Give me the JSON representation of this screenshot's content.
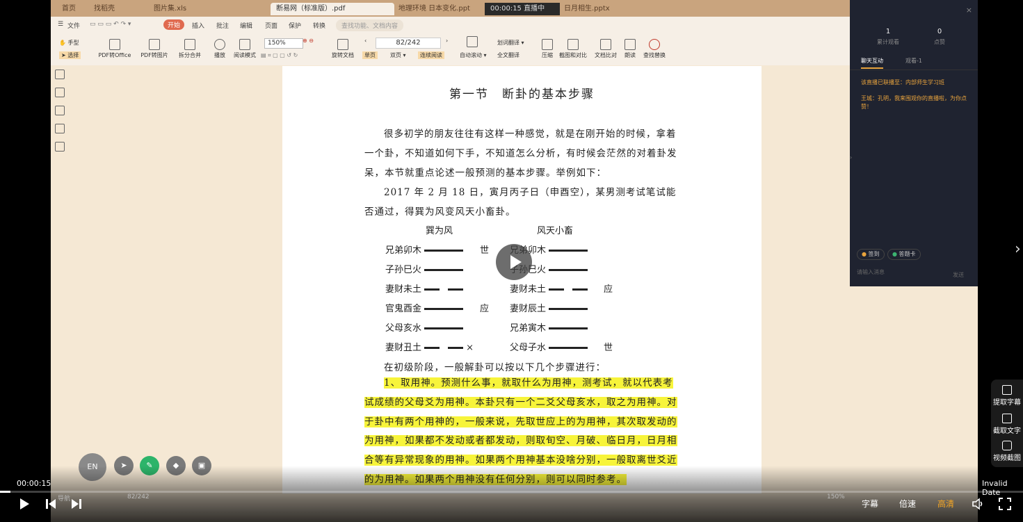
{
  "wps": {
    "tabs": [
      {
        "label": "首页"
      },
      {
        "label": "找稻壳"
      },
      {
        "label": "图片集.xls"
      },
      {
        "label": "断易网（标准版）.pdf"
      },
      {
        "label": "地理环境 日本变化.ppt"
      },
      {
        "label": "00:00:15 直播中"
      },
      {
        "label": "日月相生.pptx"
      }
    ],
    "menu": {
      "file": "文件",
      "start": "开始",
      "insert": "插入",
      "comment": "批注",
      "edit": "编辑",
      "page": "页面",
      "protect": "保护",
      "convert": "转换",
      "search_placeholder": "查找功能、文档内容"
    },
    "ribbon": {
      "hand": "手型",
      "select": "选择",
      "pdf_to_office": "PDF转Office",
      "pdf_to_image": "PDF转图片",
      "split_merge": "拆分合并",
      "play": "播放",
      "read_mode": "阅读模式",
      "zoom": "150%",
      "rotate": "旋转文档",
      "page_value": "82/242",
      "single": "单页",
      "double": "双页",
      "continuous": "连续阅读",
      "auto_scroll": "自动滚动",
      "word_translate": "划词翻译",
      "full_translate": "全文翻译",
      "compress": "压缩",
      "screenshot_compare": "截图和对比",
      "doc_compare": "文档比对",
      "read_aloud": "朗读",
      "find_replace": "查找替换"
    }
  },
  "doc": {
    "title": "第一节　断卦的基本步骤",
    "p1": "很多初学的朋友往往有这样一种感觉，就是在刚开始的时候，拿着一个卦，不知道如何下手，不知道怎么分析，有时候会茫然的对着卦发呆，本节就重点论述一般预测的基本步骤。举例如下：",
    "p2": "2017 年 2 月 18 日，寅月丙子日（申酉空），某男测考试笔试能否通过，得巽为风变风天小畜卦。",
    "hex_left_title": "巽为风",
    "hex_right_title": "风天小畜",
    "left_lines": [
      "兄弟卯木",
      "子孙巳火",
      "妻财未土",
      "官鬼酉金",
      "父母亥水",
      "妻财丑土"
    ],
    "right_lines": [
      "兄弟卯木",
      "子孙巳火",
      "妻财未土",
      "妻财辰土",
      "兄弟寅木",
      "父母子水"
    ],
    "shi": "世",
    "ying": "应",
    "cross": "×",
    "p3": "在初级阶段，一般解卦可以按以下几个步骤进行：",
    "p4": "1、取用神。预测什么事，就取什么为用神，测考试，就以代表考试成绩的父母爻为用神。本卦只有一个二爻父母亥水，取之为用神。对于卦中有两个用神的，一般来说，先取世应上的为用神，其次取发动的为用神，如果都不发动或者都发动，则取旬空、月破、临日月，日月相合等有异常现象的用神。如果两个用神基本没啥分别，一般取离世爻近的为用神。如果两个用神没有任何分别，则可以同时参考。"
  },
  "live": {
    "total_views_num": "1",
    "total_views_label": "累计观看",
    "likes_num": "0",
    "likes_label": "点赞",
    "tab_chat": "聊天互动",
    "tab_viewers": "观看-1",
    "msg1": "该直播已联播至：内部师生学习班",
    "msg2": "王城：孔明，我来围观你的直播啦，为你点赞！",
    "signin": "签到",
    "card": "答题卡",
    "input_placeholder": "请输入消息",
    "send": "发送"
  },
  "drawtools": {
    "en": "EN"
  },
  "bottom_bar": {
    "label": "导航",
    "page": "82/242",
    "zoom": "150%"
  },
  "player": {
    "time": "00:00:15",
    "invalid": "Invalid Date",
    "progress": 0.01,
    "subtitle": "字幕",
    "speed": "倍速",
    "quality": "高清"
  },
  "side_tools": {
    "extract_subtitle": "提取字幕",
    "extract_text": "截取文字",
    "video_screenshot": "视频截图"
  },
  "colors": {
    "highlight": "#f7f43a",
    "quality_accent": "#f5a623",
    "wps_accent": "#e06a4f"
  }
}
